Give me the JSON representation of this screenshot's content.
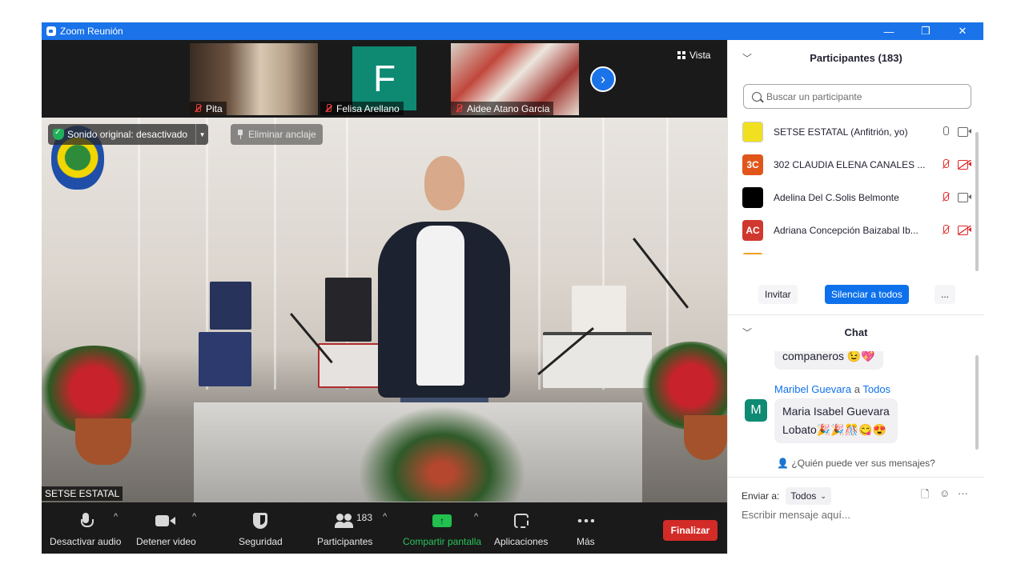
{
  "window": {
    "title": "Zoom Reunión",
    "minimize": "—",
    "restore": "❐",
    "close": "✕"
  },
  "thumbnails": [
    {
      "name": "Pita",
      "muted": true
    },
    {
      "name": "Felisa Arellano",
      "initial": "F",
      "muted": true
    },
    {
      "name": "Aidee Atano Garcia",
      "muted": true
    }
  ],
  "view_button": {
    "label": "Vista"
  },
  "main_video": {
    "sound_status": "Sonido original: desactivado",
    "unpin_label": "Eliminar anclaje",
    "name_tag": "SETSE ESTATAL"
  },
  "toolbar": {
    "mute_label": "Desactivar audio",
    "video_label": "Detener video",
    "security_label": "Seguridad",
    "participants_label": "Participantes",
    "participants_count": "183",
    "share_label": "Compartir pantalla",
    "apps_label": "Aplicaciones",
    "more_label": "Más",
    "end_label": "Finalizar",
    "caret": "^"
  },
  "participants_panel": {
    "title": "Participantes (183)",
    "search_placeholder": "Buscar un participante",
    "items": [
      {
        "name": "SETSE ESTATAL (Anfitrión, yo)",
        "initials": "",
        "avatar_color": "#f0e020",
        "mic_off": false,
        "cam_off": false
      },
      {
        "name": "302 CLAUDIA ELENA CANALES ...",
        "initials": "3C",
        "avatar_color": "#e0561a",
        "mic_off": true,
        "cam_off": true
      },
      {
        "name": "Adelina Del C.Solis Belmonte",
        "initials": "",
        "avatar_color": "#000000",
        "mic_off": true,
        "cam_off": false
      },
      {
        "name": "Adriana Concepción Baizabal Ib...",
        "initials": "AC",
        "avatar_color": "#d0382f",
        "mic_off": true,
        "cam_off": true
      }
    ],
    "invite_label": "Invitar",
    "mute_all_label": "Silenciar a todos",
    "more_label": "..."
  },
  "chat_panel": {
    "title": "Chat",
    "prev_message": "companeros 😉💖",
    "sender": "Maribel Guevara",
    "to_word": "a",
    "recipient": "Todos",
    "sender_initial": "M",
    "message_line1": "Maria Isabel Guevara",
    "message_line2": "Lobato🎉🎉🎊😋😍",
    "who_can_see": "¿Quién puede ver sus mensajes?",
    "send_to_label": "Enviar a:",
    "send_to_value": "Todos",
    "input_placeholder": "Escribir mensaje aquí..."
  }
}
